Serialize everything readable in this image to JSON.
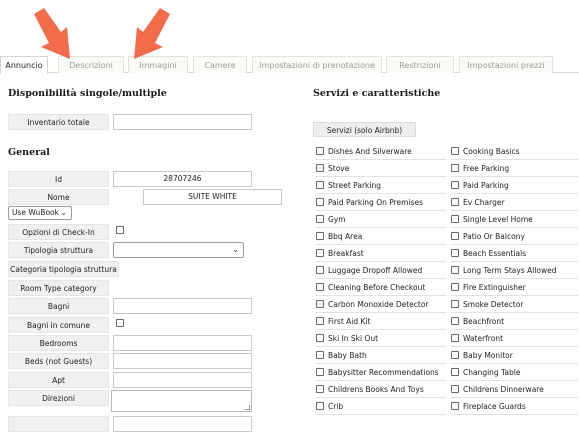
{
  "tabs": [
    {
      "label": "Annuncio",
      "active": true
    },
    {
      "label": "Descrizioni",
      "active": false
    },
    {
      "label": "Immagini",
      "active": false
    },
    {
      "label": "Camere",
      "active": false
    },
    {
      "label": "Impostazioni di prenotazione",
      "active": false
    },
    {
      "label": "Restrizioni",
      "active": false
    },
    {
      "label": "Impostazioni prezzi",
      "active": false
    }
  ],
  "annotations": {
    "arrow_color": "#f26b4b"
  },
  "left": {
    "availability_title": "Disponibilità singole/multiple",
    "inventory_label": "Inventario totale",
    "inventory_value": "",
    "general_title": "General",
    "id_label": "Id",
    "id_value": "28707246",
    "name_label": "Nome",
    "name_value": "SUITE WHITE",
    "wubook_select": "Use WuBook",
    "checkin_label": "Opzioni di Check-In",
    "structure_type_label": "Tipologia struttura",
    "structure_category_label": "Categoria tipologia struttura",
    "room_type_label": "Room Type category",
    "bathrooms_label": "Bagni",
    "shared_bathrooms_label": "Bagni in comune",
    "bedrooms_label": "Bedrooms",
    "beds_label": "Beds (not Guests)",
    "apt_label": "Apt",
    "directions_label": "Direzioni"
  },
  "right": {
    "title": "Servizi e caratteristiche",
    "airbnb_button": "Servizi (solo Airbnb)",
    "col1": [
      "Dishes And Silverware",
      "Stove",
      "Street Parking",
      "Paid Parking On Premises",
      "Gym",
      "Bbq Area",
      "Breakfast",
      "Luggage Dropoff Allowed",
      "Cleaning Before Checkout",
      "Carbon Monoxide Detector",
      "First Aid Kit",
      "Ski In Ski Out",
      "Baby Bath",
      "Babysitter Recommendations",
      "Childrens Books And Toys",
      "Crib"
    ],
    "col2": [
      "Cooking Basics",
      "Free Parking",
      "Paid Parking",
      "Ev Charger",
      "Single Level Home",
      "Patio Or Balcony",
      "Beach Essentials",
      "Long Term Stays Allowed",
      "Fire Extinguisher",
      "Smoke Detector",
      "Beachfront",
      "Waterfront",
      "Baby Monitor",
      "Changing Table",
      "Childrens Dinnerware",
      "Fireplace Guards"
    ]
  }
}
